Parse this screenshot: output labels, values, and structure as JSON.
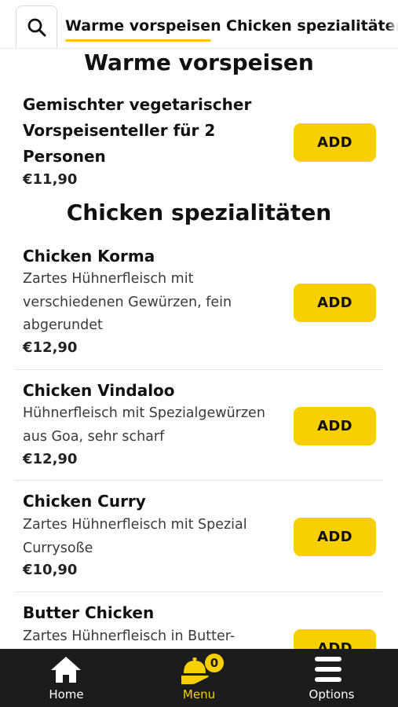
{
  "categories": {
    "tabs": [
      {
        "label": "Warme vorspeisen",
        "active": true
      },
      {
        "label": "Chicken spezialitäten",
        "active": false
      }
    ]
  },
  "sections": [
    {
      "title": "Warme vorspeisen",
      "items": [
        {
          "name": "Gemischter vegetarischer Vorspeisenteller für 2 Personen",
          "description": "",
          "price": "€11,90",
          "add_label": "ADD"
        }
      ]
    },
    {
      "title": "Chicken spezialitäten",
      "items": [
        {
          "name": "Chicken Korma",
          "description": "Zartes Hühnerfleisch mit verschiedenen Gewürzen, fein abgerundet",
          "price": "€12,90",
          "add_label": "ADD"
        },
        {
          "name": "Chicken Vindaloo",
          "description": "Hühnerfleisch mit Spezialgewürzen aus Goa, sehr scharf",
          "price": "€12,90",
          "add_label": "ADD"
        },
        {
          "name": "Chicken Curry",
          "description": "Zartes Hühnerfleisch mit Spezial Currysoße",
          "price": "€10,90",
          "add_label": "ADD"
        },
        {
          "name": "Butter Chicken",
          "description": "Zartes Hühnerfleisch in Butter-",
          "price": "",
          "add_label": "ADD"
        }
      ]
    }
  ],
  "bottom_nav": {
    "items": [
      {
        "label": "Home",
        "icon": "home-icon",
        "active": false
      },
      {
        "label": "Menu",
        "icon": "menu-bell-icon",
        "active": true
      },
      {
        "label": "Options",
        "icon": "hamburger-icon",
        "active": false
      }
    ],
    "cart_count": "0"
  },
  "colors": {
    "accent": "#f8cf00",
    "nav_background": "#1c1c1c",
    "text": "#111111"
  }
}
